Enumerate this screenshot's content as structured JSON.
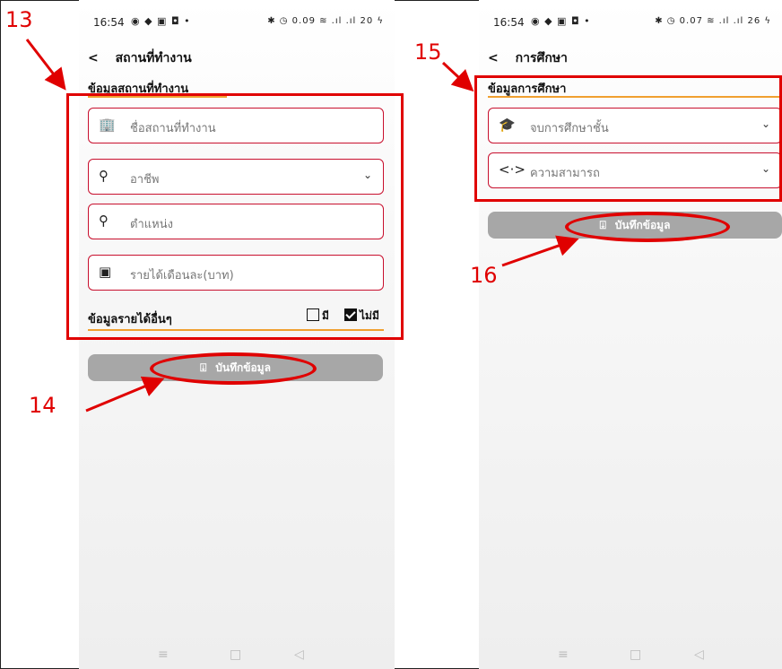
{
  "annotations": {
    "n13": "13",
    "n14": "14",
    "n15": "15",
    "n16": "16"
  },
  "left": {
    "status": {
      "time": "16:54",
      "icons": "◉ ◆ ▣ ◘ •",
      "right": "✱ ◷ 0.09 ≋ .ıl .ıl 20 ϟ"
    },
    "header": {
      "back": "<",
      "title": "สถานที่ทำงาน"
    },
    "section_title": "ข้อมูลสถานที่ทำงาน",
    "fields": [
      {
        "icon": "building-icon",
        "text": "ชื่อสถานที่ทำงาน"
      },
      {
        "icon": "person-icon",
        "text": "อาชีพ"
      },
      {
        "icon": "person-icon",
        "text": "ตำแหน่ง"
      },
      {
        "icon": "money-icon",
        "text": "รายได้เดือนละ(บาท)"
      }
    ],
    "other_income": {
      "label": "ข้อมูลรายได้อื่นๆ",
      "yes": "มี",
      "no": "ไม่มี",
      "selected": "no"
    },
    "save_label": "บันทึกข้อมูล"
  },
  "right": {
    "status": {
      "time": "16:54",
      "icons": "◉ ◆ ▣ ◘ •",
      "right": "✱ ◷ 0.07 ≋ .ıl .ıl 26 ϟ"
    },
    "header": {
      "back": "<",
      "title": "การศึกษา"
    },
    "section_title": "ข้อมูลการศึกษา",
    "fields": [
      {
        "icon": "graduation-cap-icon",
        "text": "จบการศึกษาชั้น"
      },
      {
        "icon": "code-icon",
        "text": "ความสามารถ"
      }
    ],
    "save_label": "บันทึกข้อมูล"
  },
  "navbar": {
    "menu": "≡",
    "home": "□",
    "back": "◁"
  },
  "colors": {
    "accent_red": "#c8102e",
    "annotation_red": "#e00000",
    "underline_orange": "#f0a030",
    "button_gray": "#a7a7a7"
  }
}
